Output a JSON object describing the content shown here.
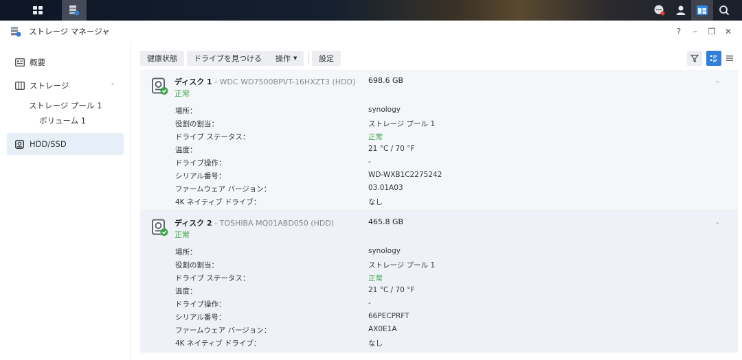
{
  "window": {
    "title": "ストレージ マネージャ"
  },
  "window_controls": {
    "help": "?",
    "minimize": "–",
    "restore": "❐",
    "close": "✕"
  },
  "sidebar": {
    "overview": "概要",
    "storage": "ストレージ",
    "pool": "ストレージ プール 1",
    "volume": "ボリューム 1",
    "hdd": "HDD/SSD"
  },
  "toolbar": {
    "health": "健康状態",
    "find": "ドライブを見つける",
    "ops": "操作",
    "settings": "設定"
  },
  "labels": {
    "location": "場所：",
    "role": "役割の割当：",
    "drive_status": "ドライブ ステータス：",
    "temperature": "温度：",
    "drive_ops": "ドライブ操作：",
    "serial": "シリアル番号：",
    "firmware": "ファームウェア バージョン：",
    "native4k": "4K ネイティブ ドライブ："
  },
  "disks": [
    {
      "name": "ディスク 1",
      "model": " - WDC WD7500BPVT-16HXZT3 (HDD)",
      "status": "正常",
      "capacity": "698.6 GB",
      "location": "synology",
      "role": "ストレージ プール 1",
      "drive_status": "正常",
      "temperature": "21 °C / 70 °F",
      "drive_ops": "-",
      "serial": "WD-WXB1C2275242",
      "firmware": "03.01A03",
      "native4k": "なし"
    },
    {
      "name": "ディスク 2",
      "model": " - TOSHIBA MQ01ABD050 (HDD)",
      "status": "正常",
      "capacity": "465.8 GB",
      "location": "synology",
      "role": "ストレージ プール 1",
      "drive_status": "正常",
      "temperature": "21 °C / 70 °F",
      "drive_ops": "-",
      "serial": "66PECPRFT",
      "firmware": "AX0E1A",
      "native4k": "なし"
    }
  ],
  "colors": {
    "accent": "#2f7fd8",
    "ok": "#3aa54a"
  },
  "icons": [
    "apps-grid-icon",
    "storage-manager-icon",
    "chat-icon",
    "user-icon",
    "widget-icon",
    "search-icon",
    "overview-icon",
    "storage-icon",
    "hdd-icon",
    "disk-icon",
    "filter-icon",
    "list-view-icon",
    "detail-view-icon"
  ]
}
